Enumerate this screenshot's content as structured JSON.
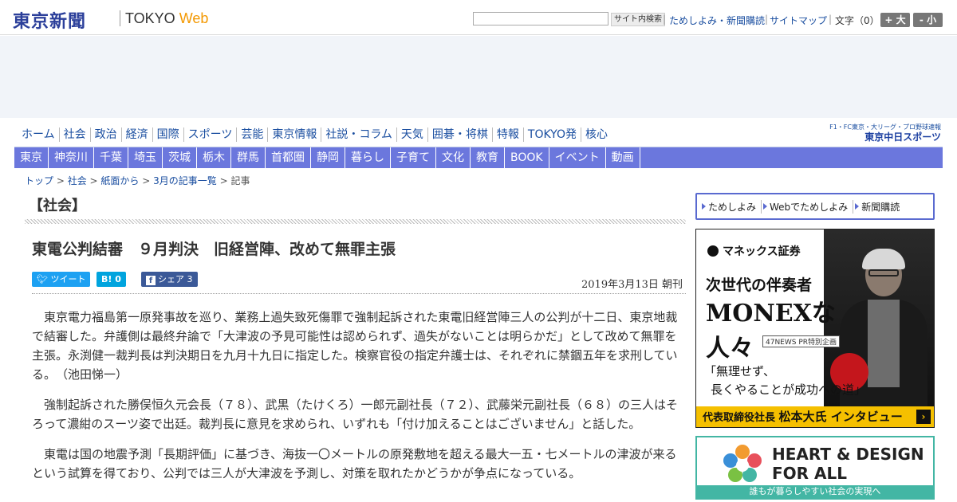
{
  "header": {
    "logo_main": "東京新聞",
    "logo_sub_a": "TOKYO ",
    "logo_sub_b": "Web",
    "search_button": "サイト内検索",
    "links": [
      "ためしよみ・新聞購読",
      "サイトマップ"
    ],
    "font_label": "文字（0）",
    "font_plus": "+ 大",
    "font_minus": "- 小"
  },
  "nav_main": [
    "ホーム",
    "社会",
    "政治",
    "経済",
    "国際",
    "スポーツ",
    "芸能",
    "東京情報",
    "社説・コラム",
    "天気",
    "囲碁・将棋",
    "特報",
    "TOKYO発",
    "核心"
  ],
  "chunichi": {
    "top": "F1・FC東京・大リーグ・プロ野球速報",
    "bottom": "東京中日スポーツ"
  },
  "nav_sub": [
    "東京",
    "神奈川",
    "千葉",
    "埼玉",
    "茨城",
    "栃木",
    "群馬",
    "首都圏",
    "静岡",
    "暮らし",
    "子育て",
    "文化",
    "教育",
    "BOOK",
    "イベント",
    "動画"
  ],
  "breadcrumb": {
    "items": [
      "トップ",
      "社会",
      "紙面から",
      "3月の記事一覧"
    ],
    "sep": " > ",
    "current": "記事"
  },
  "section_title": "【社会】",
  "article": {
    "headline": "東電公判結審　９月判決　旧経営陣、改めて無罪主張",
    "tweet_label": "ツイート",
    "hatena_label": "B!",
    "hatena_count": "0",
    "share_label": "シェア",
    "share_count": "3",
    "date": "2019年3月13日 朝刊",
    "paragraphs": [
      "東京電力福島第一原発事故を巡り、業務上過失致死傷罪で強制起訴された東電旧経営陣三人の公判が十二日、東京地裁で結審した。弁護側は最終弁論で「大津波の予見可能性は認められず、過失がないことは明らかだ」として改めて無罪を主張。永渕健一裁判長は判決期日を九月十九日に指定した。検察官役の指定弁護士は、それぞれに禁錮五年を求刑している。　（池田悌一）",
      "強制起訴された勝俣恒久元会長（７８）、武黒（たけくろ）一郎元副社長（７２）、武藤栄元副社長（６８）の三人はそろって濃紺のスーツ姿で出廷。裁判長に意見を求められ、いずれも「付け加えることはございません」と話した。",
      "東電は国の地震予測「長期評価」に基づき、海抜一〇メートルの原発敷地を超える最大一五・七メートルの津波が来るという試算を得ており、公判では三人が大津波を予測し、対策を取れたかどうかが争点になっている。"
    ]
  },
  "sidebar": {
    "links": [
      "ためしよみ",
      "Webでためしよみ",
      "新聞購読"
    ],
    "monex": {
      "logo": "マネックス証券",
      "title1": "次世代の伴奏者",
      "title2": "MONEXな",
      "title3": "人々",
      "pr": "47NEWS PR特別企画",
      "quote1": "「無理せず、",
      "quote2": "長くやることが成功への道」",
      "bar_small": "代表取締役社長 ",
      "bar_big": "松本大氏 インタビュー",
      "arrow": "›"
    },
    "heart": {
      "title1": "HEART & DESIGN",
      "title2": "FOR ALL",
      "bar": "誰もが暮らしやすい社会の実現へ"
    }
  },
  "colors": {
    "brand_blue": "#2b3f9a",
    "nav_sub_bg": "#6b77dd",
    "twitter": "#1da1f2",
    "hatena": "#00a4de",
    "facebook": "#3b5998",
    "monex_yellow": "#f5c000",
    "heart_teal": "#43b6a4"
  }
}
